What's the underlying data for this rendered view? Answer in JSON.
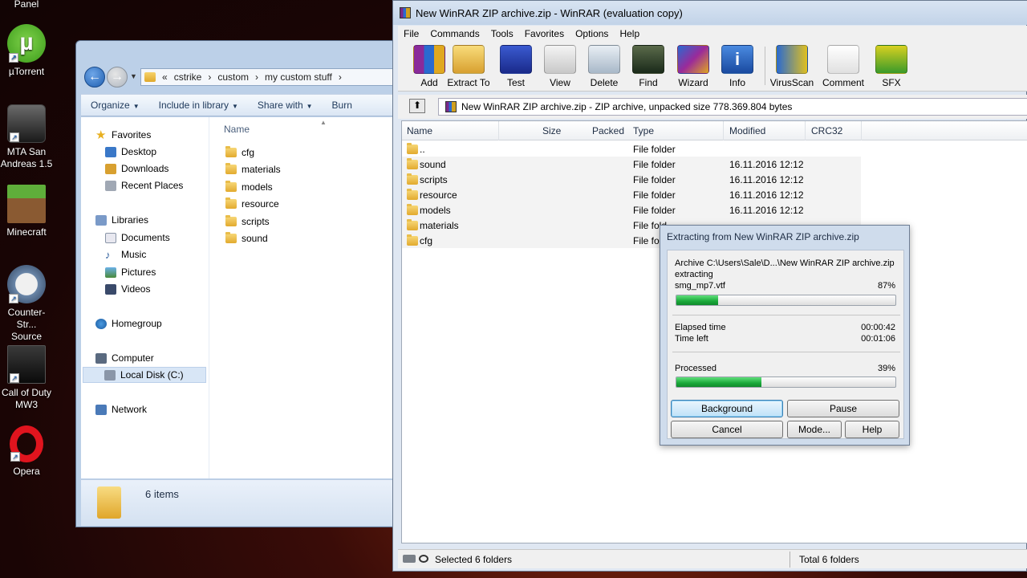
{
  "desktop": {
    "top_label": "Panel",
    "icons": [
      {
        "label": "µTorrent",
        "icon": "utorrent-icon"
      },
      {
        "label": "MTA San Andreas 1.5",
        "icon": "mta-icon"
      },
      {
        "label": "Minecraft",
        "icon": "minecraft-icon"
      },
      {
        "label": "Counter-Str... Source",
        "icon": "counter-strike-icon"
      },
      {
        "label": "Call of Duty MW3",
        "icon": "call-of-duty-icon"
      },
      {
        "label": "Opera",
        "icon": "opera-icon"
      }
    ]
  },
  "explorer": {
    "breadcrumb": {
      "prefix": "«",
      "parts": [
        "cstrike",
        "custom",
        "my custom stuff"
      ]
    },
    "toolbar": [
      "Organize",
      "Include in library",
      "Share with",
      "Burn"
    ],
    "nav": {
      "favorites": "Favorites",
      "favorites_items": [
        "Desktop",
        "Downloads",
        "Recent Places"
      ],
      "libraries": "Libraries",
      "libraries_items": [
        "Documents",
        "Music",
        "Pictures",
        "Videos"
      ],
      "homegroup": "Homegroup",
      "computer": "Computer",
      "computer_items": [
        "Local Disk (C:)"
      ],
      "network": "Network"
    },
    "column_name": "Name",
    "files": [
      "cfg",
      "materials",
      "models",
      "resource",
      "scripts",
      "sound"
    ],
    "status_count": "6 items"
  },
  "winrar": {
    "title": "New WinRAR ZIP archive.zip - WinRAR (evaluation copy)",
    "menu": [
      "File",
      "Commands",
      "Tools",
      "Favorites",
      "Options",
      "Help"
    ],
    "tools": [
      "Add",
      "Extract To",
      "Test",
      "View",
      "Delete",
      "Find",
      "Wizard",
      "Info",
      "VirusScan",
      "Comment",
      "SFX"
    ],
    "path": "New WinRAR ZIP archive.zip - ZIP archive, unpacked size 778.369.804 bytes",
    "columns": {
      "name": "Name",
      "size": "Size",
      "packed": "Packed",
      "type": "Type",
      "modified": "Modified",
      "crc": "CRC32"
    },
    "rows": [
      {
        "name": "..",
        "type": "File folder",
        "modified": ""
      },
      {
        "name": "sound",
        "type": "File folder",
        "modified": "16.11.2016 12:12"
      },
      {
        "name": "scripts",
        "type": "File folder",
        "modified": "16.11.2016 12:12"
      },
      {
        "name": "resource",
        "type": "File folder",
        "modified": "16.11.2016 12:12"
      },
      {
        "name": "models",
        "type": "File folder",
        "modified": "16.11.2016 12:12"
      },
      {
        "name": "materials",
        "type": "File fold",
        "modified": ""
      },
      {
        "name": "cfg",
        "type": "File fold",
        "modified": ""
      }
    ],
    "status_left": "Selected 6 folders",
    "status_right": "Total 6 folders"
  },
  "dialog": {
    "title": "Extracting from New WinRAR ZIP archive.zip",
    "archive_line": "Archive C:\\Users\\Sale\\D...\\New WinRAR ZIP archive.zip",
    "action": "extracting",
    "file": "smg_mp7.vtf",
    "file_percent": "87%",
    "file_progress": 0.19,
    "elapsed_label": "Elapsed time",
    "elapsed": "00:00:42",
    "left_label": "Time left",
    "left": "00:01:06",
    "processed_label": "Processed",
    "processed_percent": "39%",
    "processed_progress": 0.39,
    "buttons": {
      "background": "Background",
      "pause": "Pause",
      "cancel": "Cancel",
      "mode": "Mode...",
      "help": "Help"
    }
  }
}
